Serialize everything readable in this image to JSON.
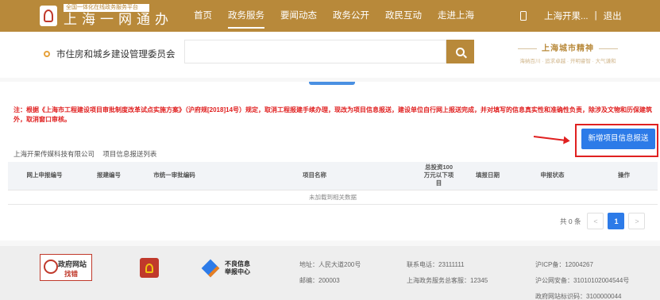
{
  "header": {
    "logo_sub": "全国一体化在线政务服务平台",
    "logo_main": "上海一网通办",
    "nav": [
      "首页",
      "政务服务",
      "要闻动态",
      "政务公开",
      "政民互动",
      "走进上海"
    ],
    "active_nav": "政务服务",
    "user_name": "上海开果...",
    "separator": "|",
    "logout": "退出",
    "accent_color": "#b8893a"
  },
  "search": {
    "department": "市住房和城乡建设管理委员会",
    "placeholder": "",
    "brand_title": "上海城市精神",
    "brand_sub": "海纳百川 · 追求卓越 · 开明睿智 · 大气谦和"
  },
  "main": {
    "notice": "注：根据《上海市工程建设项目审批制度改革试点实施方案》（沪府规[2018]14号）规定，取消工程报建手续办理，现改为项目信息报送，建设单位自行网上报送完成，并对填写的信息真实性和准确性负责，除涉及文物和历保建筑外，取消窗口审核。",
    "add_button": "新增项目信息报送",
    "breadcrumb": [
      "上海开果传媒科技有限公司",
      "项目信息报送列表"
    ],
    "table": {
      "columns": [
        "网上申报编号",
        "报建编号",
        "市统一审批编码",
        "项目名称",
        "总投资100万元以下项目",
        "填报日期",
        "申报状态",
        "操作"
      ],
      "empty_text": "未加载到相关数据"
    },
    "pager": {
      "total": "共 0 条",
      "prev": "<",
      "current": "1",
      "next": ">"
    },
    "accent_color": "#2d7be8",
    "notice_color": "#e02020"
  },
  "footer": {
    "logo1_title": "政府网站",
    "logo1_sub": "找错",
    "logo3_text_line1": "不良信息",
    "logo3_text_line2": "举报中心",
    "address": "地址：人民大道200号",
    "postcode": "邮编：200003",
    "phone": "联系电话：23111111",
    "service": "上海政务服务总客服：12345",
    "icp": "沪ICP备：12004267",
    "police": "沪公网安备：31010102004544号",
    "site_id": "政府网站标识码：3100000044"
  }
}
